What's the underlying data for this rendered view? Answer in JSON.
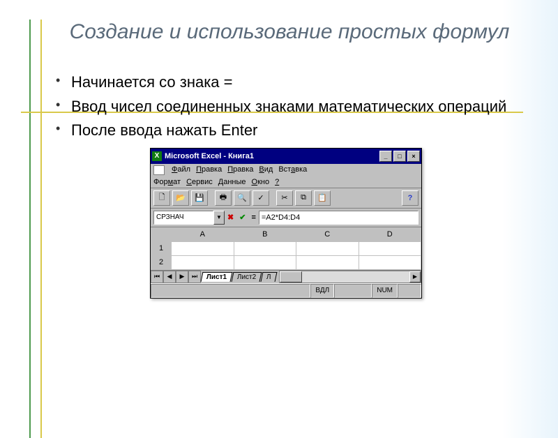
{
  "slide": {
    "title": "Создание и использование простых формул",
    "bullets": [
      "Начинается со знака =",
      "Ввод чисел соединенных знаками математических операций",
      "После ввода нажать Enter"
    ]
  },
  "excel": {
    "title": "Microsoft Excel - Книга1",
    "menu_row1": [
      "Файл",
      "Правка",
      "Правка",
      "Вид",
      "Вставка"
    ],
    "menu_row2": [
      "Формат",
      "Сервис",
      "Данные",
      "Окно",
      "?"
    ],
    "namebox": "СРЗНАЧ",
    "formula": "=A2*D4:D4",
    "columns": [
      "A",
      "B",
      "C",
      "D"
    ],
    "rows": [
      "1",
      "2"
    ],
    "tabs": [
      "Лист1",
      "Лист2",
      "Л"
    ],
    "status": {
      "mode": "ВДЛ",
      "num": "NUM"
    }
  }
}
